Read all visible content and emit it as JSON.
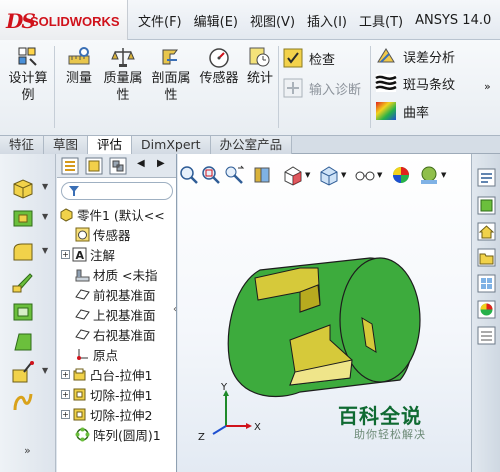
{
  "app": {
    "logo_ds": "DS",
    "logo_name": "SOLIDWORKS"
  },
  "menu": {
    "items": [
      "文件(F)",
      "编辑(E)",
      "视图(V)",
      "插入(I)",
      "工具(T)",
      "ANSYS 14.0"
    ]
  },
  "ribbon": {
    "design_study": [
      "设计算",
      "例"
    ],
    "measure": "测量",
    "mass_props": [
      "质量属",
      "性"
    ],
    "section_props": [
      "剖面属",
      "性"
    ],
    "sensor": "传感器",
    "stats": "统计",
    "check": "检查",
    "import_diag": "输入诊断",
    "deviation": "误差分析",
    "zebra": "斑马条纹",
    "curvature": "曲率"
  },
  "tabs": [
    "特征",
    "草图",
    "评估",
    "DimXpert",
    "办公室产品"
  ],
  "active_tab": "评估",
  "tree": {
    "root": "零件1 (默认<<",
    "nodes": [
      "传感器",
      "注解",
      "材质 <未指",
      "前视基准面",
      "上视基准面",
      "右视基准面",
      "原点",
      "凸台-拉伸1",
      "切除-拉伸1",
      "切除-拉伸2",
      "阵列(圆周)1"
    ]
  },
  "triad": {
    "x": "X",
    "y": "Y",
    "z": "Z"
  },
  "watermark": {
    "title": "百科全说",
    "subtitle": "助你轻松解决"
  },
  "colors": {
    "part_green": "#3dab3d",
    "part_yellow": "#d6c93a",
    "logo_red": "#d0121b"
  }
}
